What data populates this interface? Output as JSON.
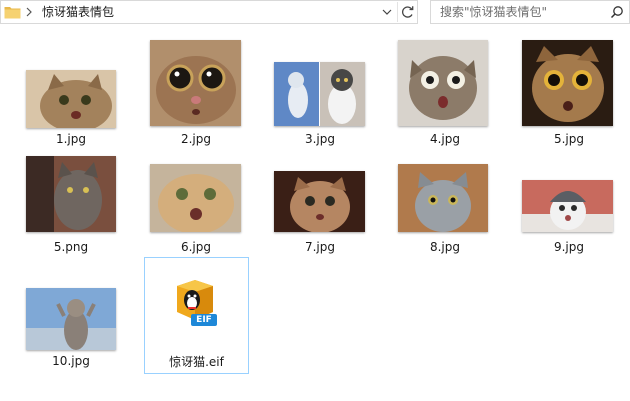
{
  "address_bar": {
    "breadcrumb": "惊讶猫表情包",
    "search_placeholder": "搜索\"惊讶猫表情包\""
  },
  "icons": {
    "folder": "folder-icon",
    "breadcrumb_separator": "chevron-right-icon",
    "dropdown": "chevron-down-icon",
    "refresh": "refresh-icon",
    "search": "search-icon",
    "qq_package": "qq-penguin-icon"
  },
  "files": [
    {
      "name": "1.jpg"
    },
    {
      "name": "2.jpg"
    },
    {
      "name": "3.jpg"
    },
    {
      "name": "4.jpg"
    },
    {
      "name": "5.jpg"
    },
    {
      "name": "5.png"
    },
    {
      "name": "6.jpg"
    },
    {
      "name": "7.jpg"
    },
    {
      "name": "8.jpg"
    },
    {
      "name": "9.jpg"
    },
    {
      "name": "10.jpg"
    },
    {
      "name": "惊讶猫.eif",
      "badge": "EIF"
    }
  ],
  "colors": {
    "selection_border": "#99d1ff",
    "eif_badge": "#1e88d8",
    "box_gold": "#f0a81c"
  }
}
